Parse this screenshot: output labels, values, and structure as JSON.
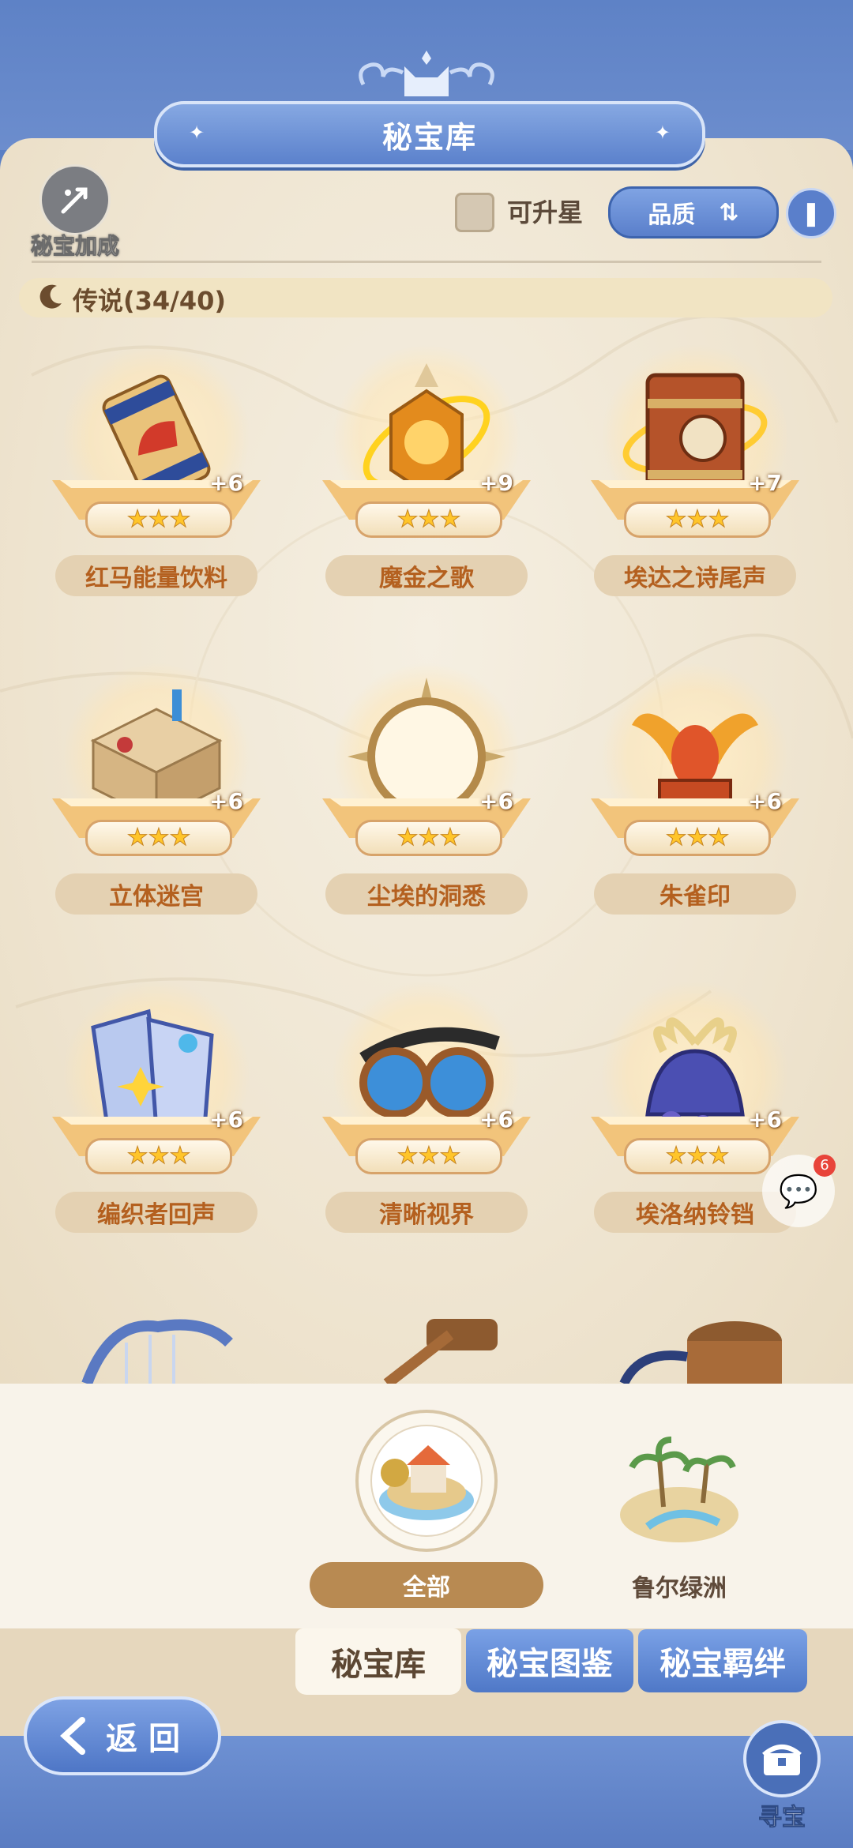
{
  "header": {
    "title": "秘宝库"
  },
  "controls": {
    "bonus_label": "秘宝加成",
    "upgradable_label": "可升星",
    "sort_label": "品质"
  },
  "category": {
    "label": "传说(34/40)"
  },
  "items": [
    {
      "name": "红马能量饮料",
      "stars": "★★★",
      "plus": "+6",
      "icon": "energy-drink-can"
    },
    {
      "name": "魔金之歌",
      "stars": "★★★",
      "plus": "+9",
      "icon": "golden-lantern"
    },
    {
      "name": "埃达之诗尾声",
      "stars": "★★★",
      "plus": "+7",
      "icon": "ancient-book"
    },
    {
      "name": "立体迷宫",
      "stars": "★★★",
      "plus": "+6",
      "icon": "maze-cube"
    },
    {
      "name": "尘埃的洞悉",
      "stars": "★★★",
      "plus": "+6",
      "icon": "sun-mirror"
    },
    {
      "name": "朱雀印",
      "stars": "★★★",
      "plus": "+6",
      "icon": "phoenix-seal"
    },
    {
      "name": "编织者回声",
      "stars": "★★★",
      "plus": "+6",
      "icon": "woven-frames"
    },
    {
      "name": "清晰视界",
      "stars": "★★★",
      "plus": "+6",
      "icon": "goggles"
    },
    {
      "name": "埃洛纳铃铛",
      "stars": "★★★",
      "plus": "+6",
      "icon": "ribbon-bell"
    }
  ],
  "chat": {
    "badge": "6"
  },
  "regions": {
    "all_label": "全部",
    "oasis_label": "鲁尔绿洲"
  },
  "tabs": [
    {
      "label": "秘宝库"
    },
    {
      "label": "秘宝图鉴"
    },
    {
      "label": "秘宝羁绊"
    }
  ],
  "footer": {
    "back_label": "返回",
    "treasure_label": "寻宝"
  },
  "colors": {
    "accent_blue": "#5a7fcb",
    "panel_bg": "#f1e8d6",
    "name_text": "#b4601f",
    "star": "#ffc52a"
  }
}
